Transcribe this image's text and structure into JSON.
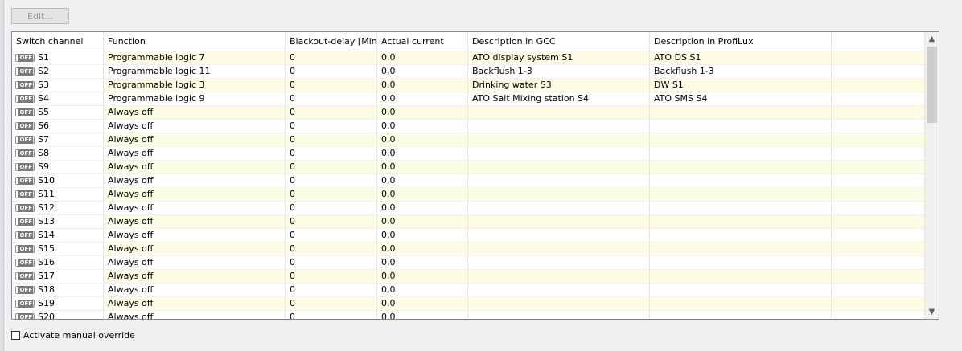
{
  "toolbar": {
    "edit_label": "Edit..."
  },
  "table": {
    "columns": [
      "Switch channel",
      "Function",
      "Blackout-delay [Min]",
      "Actual current",
      "Description in GCC",
      "Description in ProfiLux",
      ""
    ],
    "toggle_label": "OFF",
    "rows": [
      {
        "channel": "S1",
        "function": "Programmable logic 7",
        "delay": "0",
        "current": "0,0",
        "gcc": "ATO display system S1",
        "profilux": "ATO DS S1"
      },
      {
        "channel": "S2",
        "function": "Programmable logic 11",
        "delay": "0",
        "current": "0,0",
        "gcc": "Backflush 1-3",
        "profilux": "Backflush 1-3"
      },
      {
        "channel": "S3",
        "function": "Programmable logic 3",
        "delay": "0",
        "current": "0,0",
        "gcc": "Drinking water S3",
        "profilux": "DW S1"
      },
      {
        "channel": "S4",
        "function": "Programmable logic 9",
        "delay": "0",
        "current": "0,0",
        "gcc": "ATO Salt Mixing station S4",
        "profilux": "ATO SMS S4"
      },
      {
        "channel": "S5",
        "function": "Always off",
        "delay": "0",
        "current": "0,0",
        "gcc": "",
        "profilux": ""
      },
      {
        "channel": "S6",
        "function": "Always off",
        "delay": "0",
        "current": "0,0",
        "gcc": "",
        "profilux": ""
      },
      {
        "channel": "S7",
        "function": "Always off",
        "delay": "0",
        "current": "0,0",
        "gcc": "",
        "profilux": ""
      },
      {
        "channel": "S8",
        "function": "Always off",
        "delay": "0",
        "current": "0,0",
        "gcc": "",
        "profilux": ""
      },
      {
        "channel": "S9",
        "function": "Always off",
        "delay": "0",
        "current": "0,0",
        "gcc": "",
        "profilux": ""
      },
      {
        "channel": "S10",
        "function": "Always off",
        "delay": "0",
        "current": "0,0",
        "gcc": "",
        "profilux": ""
      },
      {
        "channel": "S11",
        "function": "Always off",
        "delay": "0",
        "current": "0,0",
        "gcc": "",
        "profilux": ""
      },
      {
        "channel": "S12",
        "function": "Always off",
        "delay": "0",
        "current": "0,0",
        "gcc": "",
        "profilux": ""
      },
      {
        "channel": "S13",
        "function": "Always off",
        "delay": "0",
        "current": "0,0",
        "gcc": "",
        "profilux": ""
      },
      {
        "channel": "S14",
        "function": "Always off",
        "delay": "0",
        "current": "0,0",
        "gcc": "",
        "profilux": ""
      },
      {
        "channel": "S15",
        "function": "Always off",
        "delay": "0",
        "current": "0,0",
        "gcc": "",
        "profilux": ""
      },
      {
        "channel": "S16",
        "function": "Always off",
        "delay": "0",
        "current": "0,0",
        "gcc": "",
        "profilux": ""
      },
      {
        "channel": "S17",
        "function": "Always off",
        "delay": "0",
        "current": "0,0",
        "gcc": "",
        "profilux": ""
      },
      {
        "channel": "S18",
        "function": "Always off",
        "delay": "0",
        "current": "0,0",
        "gcc": "",
        "profilux": ""
      },
      {
        "channel": "S19",
        "function": "Always off",
        "delay": "0",
        "current": "0,0",
        "gcc": "",
        "profilux": ""
      },
      {
        "channel": "S20",
        "function": "Always off",
        "delay": "0",
        "current": "0,0",
        "gcc": "",
        "profilux": ""
      }
    ]
  },
  "scrollbar": {
    "up_icon": "chevron-up-icon",
    "down_icon": "chevron-down-icon"
  },
  "override": {
    "label": "Activate manual override",
    "checked": false
  },
  "colors": {
    "row_alt": "#fdfde6",
    "grid_border": "#828790",
    "toggle_off": "#7a7a7a"
  }
}
